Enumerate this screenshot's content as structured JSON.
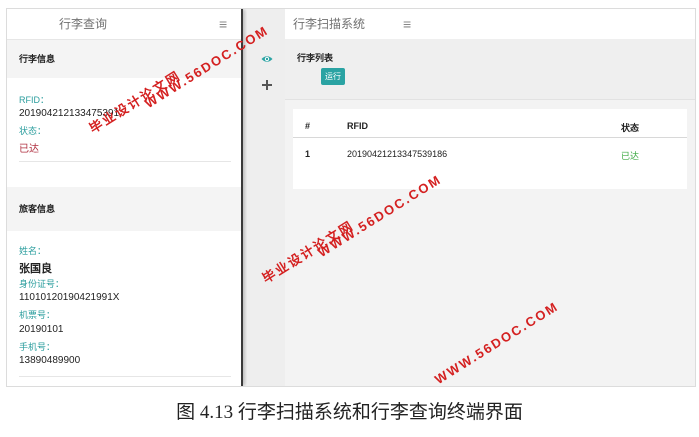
{
  "query_panel": {
    "title": "行李查询",
    "menu_icon": "hamburger-icon",
    "luggage_section": "行李信息",
    "rfid_label": "RFID：",
    "rfid_value": "201904212133475391",
    "status_label": "状态：",
    "status_value": "已达",
    "passenger_section": "旅客信息",
    "name_label": "姓名：",
    "name_value": "张国良",
    "id_label": "身份证号：",
    "id_value": "11010120190421991X",
    "ticket_label": "机票号：",
    "ticket_value": "20190101",
    "phone_label": "手机号：",
    "phone_value": "13890489900"
  },
  "icon_column": {
    "icons": [
      "eye-icon",
      "plus-icon"
    ]
  },
  "scan_panel": {
    "title": "行李扫描系统",
    "menu_icon": "hamburger-icon",
    "list_title": "行李列表",
    "run_button": "运行",
    "table": {
      "headers": [
        "#",
        "RFID",
        "状态"
      ],
      "rows": [
        {
          "index": "1",
          "rfid": "20190421213347539186",
          "status": "已达"
        }
      ]
    }
  },
  "watermarks": {
    "cn": "毕业设计论文网",
    "url": "WWW.56DOC.COM"
  },
  "caption": "图 4.13  行李扫描系统和行李查询终端界面",
  "colors": {
    "accent_teal": "#2aa3a3",
    "status_red": "#b03040",
    "status_green": "#3aa840",
    "watermark_red": "#d42020"
  }
}
